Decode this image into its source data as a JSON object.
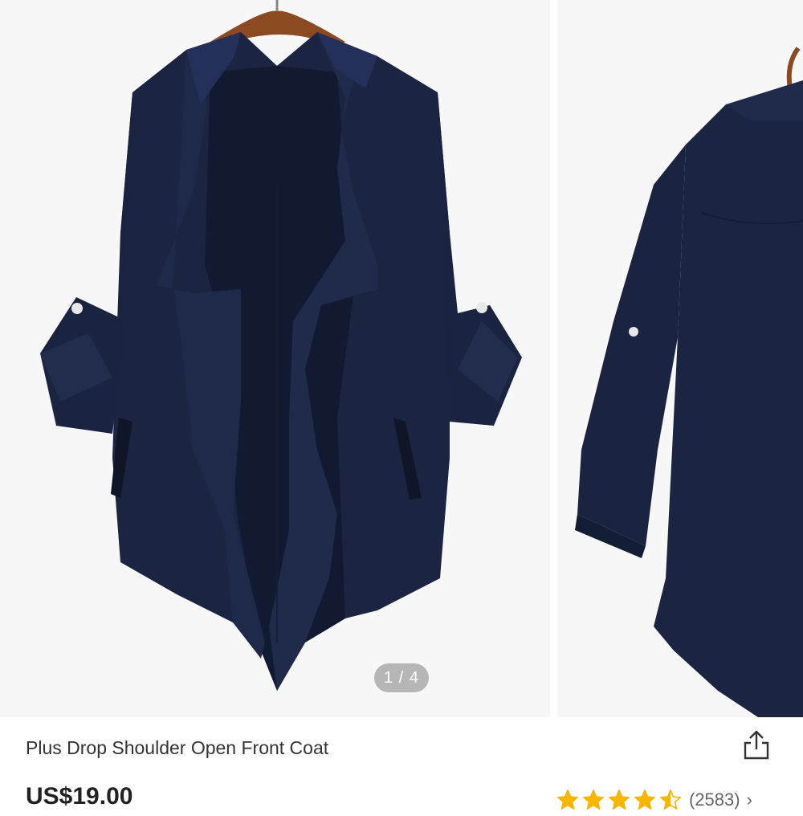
{
  "gallery": {
    "counter": "1 / 4",
    "images": [
      {
        "subject": "navy open front coat, front view, on wooden hanger"
      },
      {
        "subject": "navy open front coat, side view"
      }
    ]
  },
  "product": {
    "title": "Plus Drop Shoulder Open Front Coat",
    "price": "US$19.00"
  },
  "rating": {
    "stars": 4.5,
    "count": "(2583)",
    "chevron": "›"
  },
  "colors": {
    "coat": "#1b2541",
    "coat_shadow": "#111a31",
    "star": "#f6b600",
    "background": "#f7f7f7"
  },
  "icons": {
    "share": "share-icon",
    "chevron": "chevron-right-icon",
    "star": "star-icon"
  }
}
